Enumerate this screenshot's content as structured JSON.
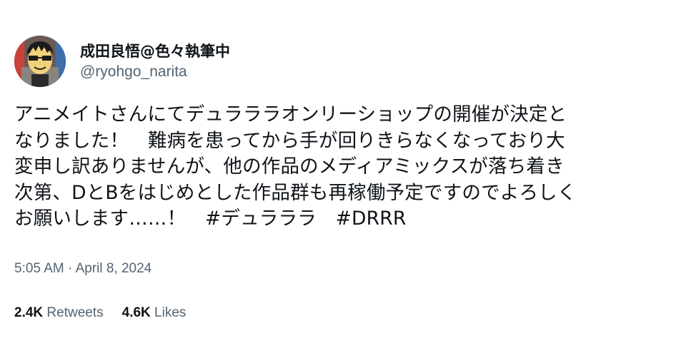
{
  "author": {
    "display_name": "成田良悟@色々執筆中",
    "handle": "@ryohgo_narita"
  },
  "tweet": {
    "lines": [
      "アニメイトさんにてデュラララオンリーショップの開催が決定と",
      "なりました！　難病を患ってから手が回りきらなくなっており大",
      "変申し訳ありませんが、他の作品のメディアミックスが落ち着き",
      "次第、DとBをはじめとした作品群も再稼働予定ですのでよろしく",
      "お願いします……！　"
    ],
    "hashtags": [
      "#デュラララ",
      "#DRRR"
    ]
  },
  "meta": {
    "time": "5:05 AM",
    "separator": "·",
    "date": "April 8, 2024"
  },
  "stats": {
    "retweets_count": "2.4K",
    "retweets_label": "Retweets",
    "likes_count": "4.6K",
    "likes_label": "Likes"
  }
}
